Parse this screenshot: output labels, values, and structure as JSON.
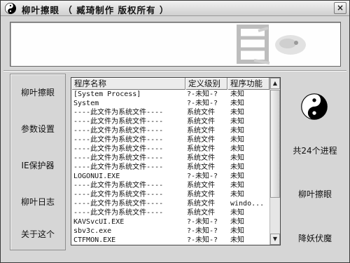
{
  "window": {
    "title": "柳叶擦眼 （ 臧琦制作 版权所有 ）",
    "close_label": "×"
  },
  "nav": {
    "items": [
      "柳叶擦眼",
      "参数设置",
      "IE保护器",
      "柳叶日志",
      "关于这个"
    ]
  },
  "table": {
    "columns": [
      "程序名称",
      "定义级别",
      "程序功能"
    ],
    "rows": [
      [
        "[System Process]",
        "?-未知-?",
        "未知"
      ],
      [
        "System",
        "?-未知-?",
        "未知"
      ],
      [
        "----此文件为系统文件----",
        "系统文件",
        "未知"
      ],
      [
        "----此文件为系统文件----",
        "系统文件",
        "未知"
      ],
      [
        "----此文件为系统文件----",
        "系统文件",
        "未知"
      ],
      [
        "----此文件为系统文件----",
        "系统文件",
        "未知"
      ],
      [
        "----此文件为系统文件----",
        "系统文件",
        "未知"
      ],
      [
        "----此文件为系统文件----",
        "系统文件",
        "未知"
      ],
      [
        "----此文件为系统文件----",
        "系统文件",
        "未知"
      ],
      [
        "LOGONUI.EXE",
        "?-未知-?",
        "未知"
      ],
      [
        "----此文件为系统文件----",
        "系统文件",
        "未知"
      ],
      [
        "----此文件为系统文件----",
        "系统文件",
        "未知"
      ],
      [
        "----此文件为系统文件----",
        "系统文件",
        "windo..."
      ],
      [
        "----此文件为系统文件----",
        "系统文件",
        "未知"
      ],
      [
        "KAVSvcUI.EXE",
        "?-未知-?",
        "未知"
      ],
      [
        "sbv3c.exe",
        "?-未知-?",
        "未知"
      ],
      [
        "CTFMON.EXE",
        "?-未知-?",
        "未知"
      ]
    ]
  },
  "right_panel": {
    "process_count": "共24个进程",
    "scan_button": "柳叶擦眼",
    "kill_button": "降妖伏魔"
  },
  "icons": {
    "title": "yin-yang-icon",
    "panel": "yin-yang-icon",
    "banner": "calligraphy-decoration"
  }
}
